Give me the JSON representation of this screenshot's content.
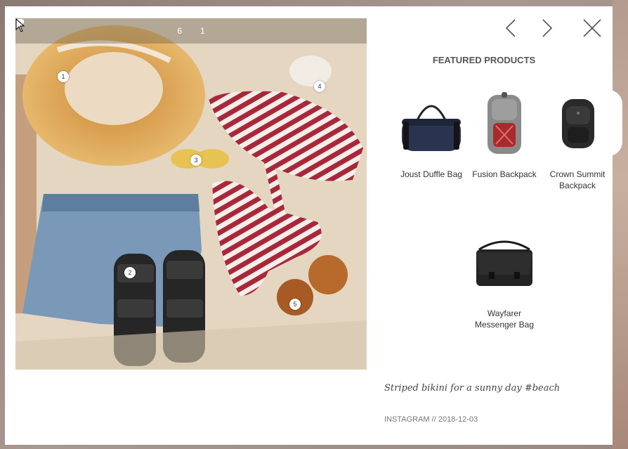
{
  "post": {
    "likes": "6",
    "comments": "1",
    "caption": "Striped bikini for a sunny day #beach",
    "source": "INSTAGRAM",
    "separator": "//",
    "date": "2018-12-03",
    "hotspots": [
      "1",
      "2",
      "3",
      "4",
      "5"
    ]
  },
  "featured": {
    "title": "FEATURED PRODUCTS",
    "products": [
      {
        "name": "Joust Duffle Bag",
        "icon": "duffle-bag"
      },
      {
        "name": "Fusion Backpack",
        "icon": "backpack"
      },
      {
        "name": "Crown Summit Backpack",
        "icon": "backpack"
      },
      {
        "name": "Wayfarer Messenger Bag",
        "icon": "messenger-bag"
      }
    ]
  },
  "nav": {
    "prev_icon": "chevron-left-icon",
    "next_icon": "chevron-right-icon",
    "close_icon": "close-icon"
  }
}
